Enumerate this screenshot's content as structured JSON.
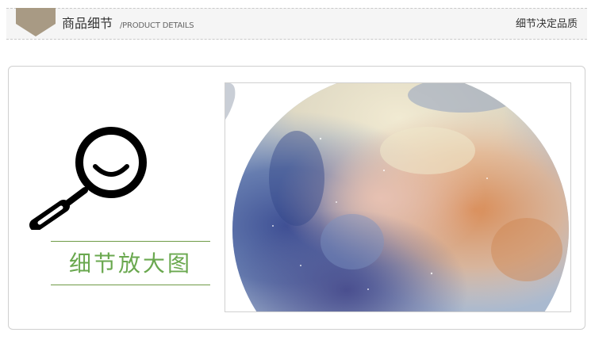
{
  "header": {
    "title": "商品细节",
    "subtitle": "/PRODUCT DETAILS",
    "slogan": "细节决定品质",
    "tag_color": "#a89a84"
  },
  "panel": {
    "magnifier_icon": "magnifier-icon",
    "label": "细节放大图",
    "accent_color": "#6aa84f",
    "line_color": "#6f9b47"
  }
}
